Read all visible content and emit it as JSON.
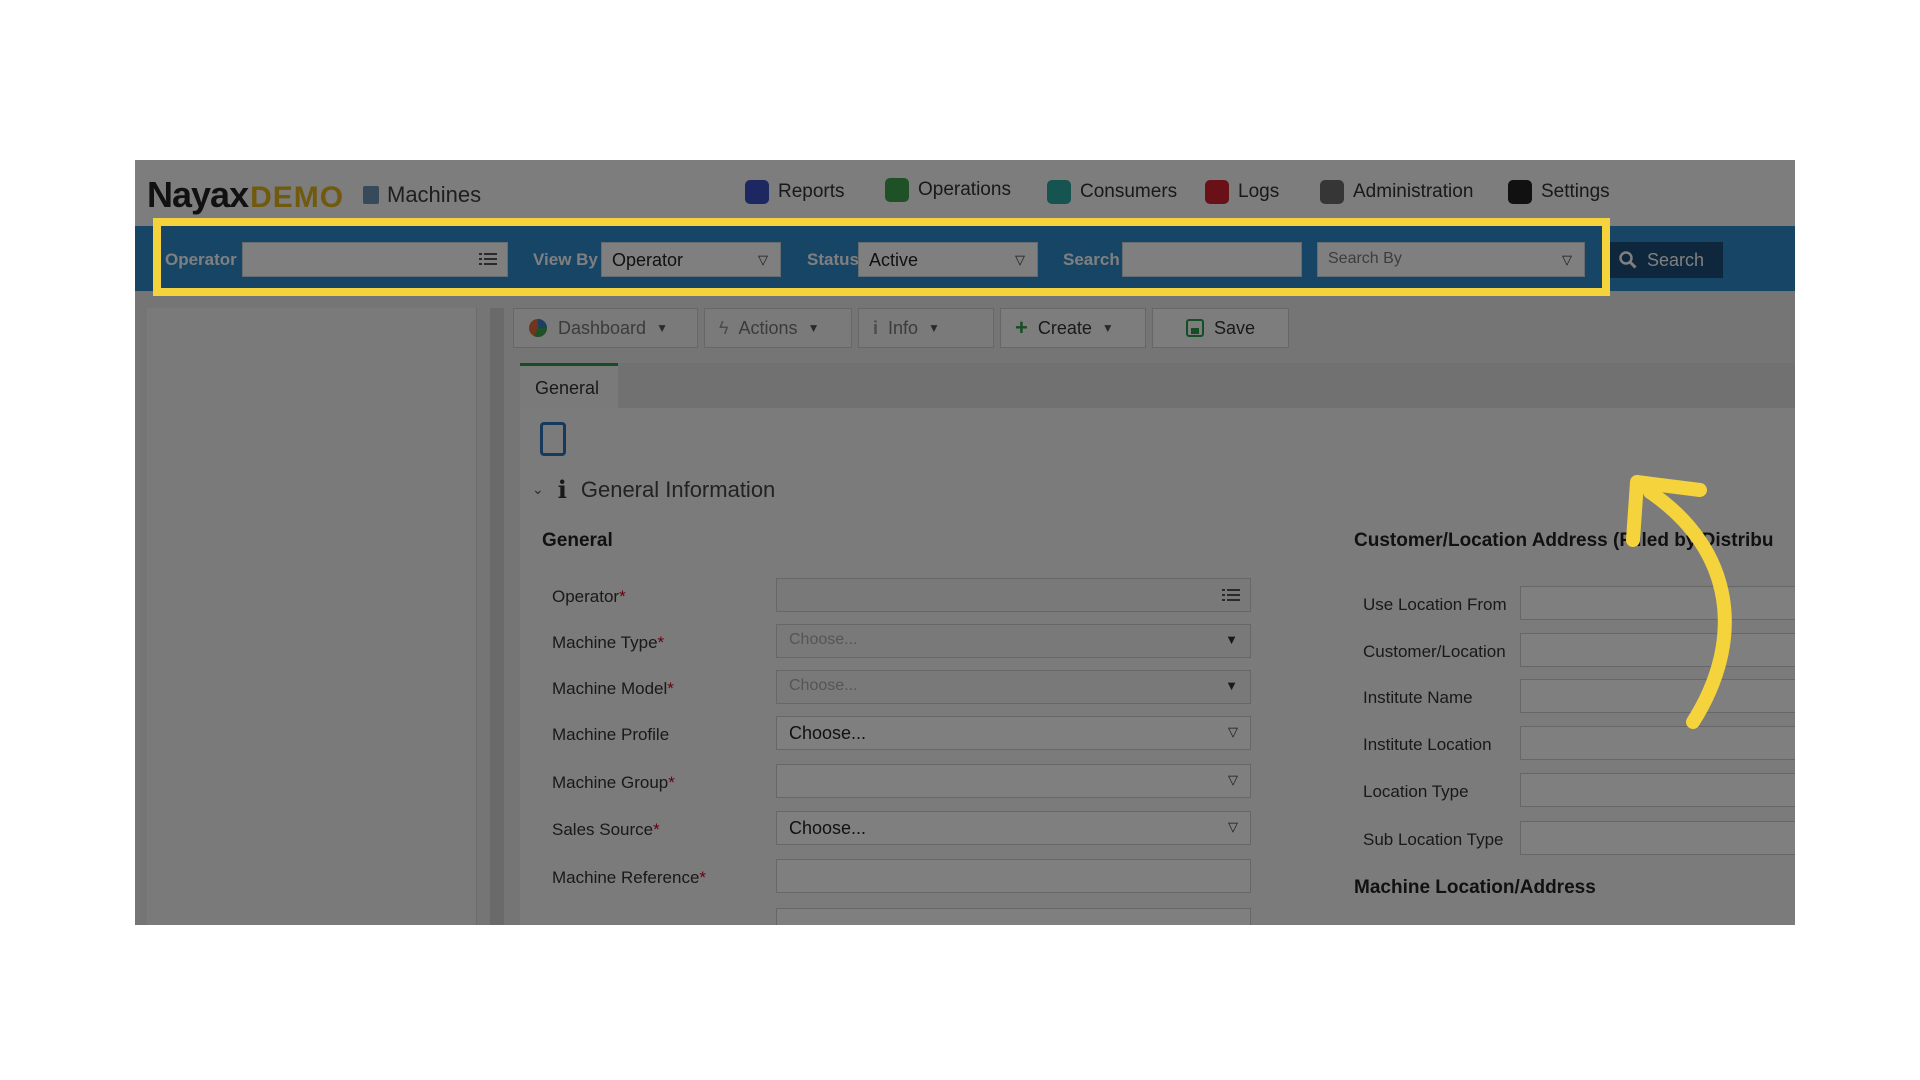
{
  "header": {
    "brand": "Nayax",
    "brand_suffix": "DEMO",
    "module_title": "Machines",
    "nav": [
      {
        "label": "Reports",
        "icon": "reports-icon",
        "color": "#3b4fc4"
      },
      {
        "label": "Operations",
        "icon": "operations-icon",
        "color": "#3fa34d"
      },
      {
        "label": "Consumers",
        "icon": "consumers-icon",
        "color": "#2aa9a0"
      },
      {
        "label": "Logs",
        "icon": "logs-icon",
        "color": "#d4232f"
      },
      {
        "label": "Administration",
        "icon": "administration-icon",
        "color": "#6d6d6d"
      },
      {
        "label": "Settings",
        "icon": "settings-icon",
        "color": "#222222"
      }
    ]
  },
  "filters": {
    "operator_label": "Operator",
    "operator_value": "",
    "view_by_label": "View By",
    "view_by_value": "Operator",
    "status_label": "Status",
    "status_value": "Active",
    "search_label": "Search",
    "search_value": "",
    "search_by_placeholder": "Search By",
    "search_button": "Search"
  },
  "toolbar": {
    "dashboard": "Dashboard",
    "actions": "Actions",
    "info": "Info",
    "create": "Create",
    "save": "Save"
  },
  "tabs": {
    "general": "General"
  },
  "section": {
    "title": "General Information"
  },
  "left_form": {
    "title": "General",
    "fields": [
      {
        "label": "Operator",
        "required": "*",
        "value": ""
      },
      {
        "label": "Machine Type",
        "required": "*",
        "value": "Choose..."
      },
      {
        "label": "Machine Model",
        "required": "*",
        "value": "Choose..."
      },
      {
        "label": "Machine Profile",
        "required": "",
        "value": "Choose..."
      },
      {
        "label": "Machine Group",
        "required": "*",
        "value": ""
      },
      {
        "label": "Sales Source",
        "required": "*",
        "value": "Choose..."
      },
      {
        "label": "Machine Reference",
        "required": "*",
        "value": ""
      }
    ]
  },
  "right_form": {
    "title": "Customer/Location Address (Filled by Distribu",
    "fields": [
      {
        "label": "Use Location From"
      },
      {
        "label": "Customer/Location"
      },
      {
        "label": "Institute Name"
      },
      {
        "label": "Institute Location"
      },
      {
        "label": "Location Type"
      },
      {
        "label": "Sub Location Type"
      }
    ],
    "next_title": "Machine Location/Address"
  },
  "colors": {
    "filter_bar": "#2f8bcb",
    "highlight": "#f5d33d",
    "accent_green": "#2d9b4a",
    "search_button": "#1d4f7a"
  }
}
